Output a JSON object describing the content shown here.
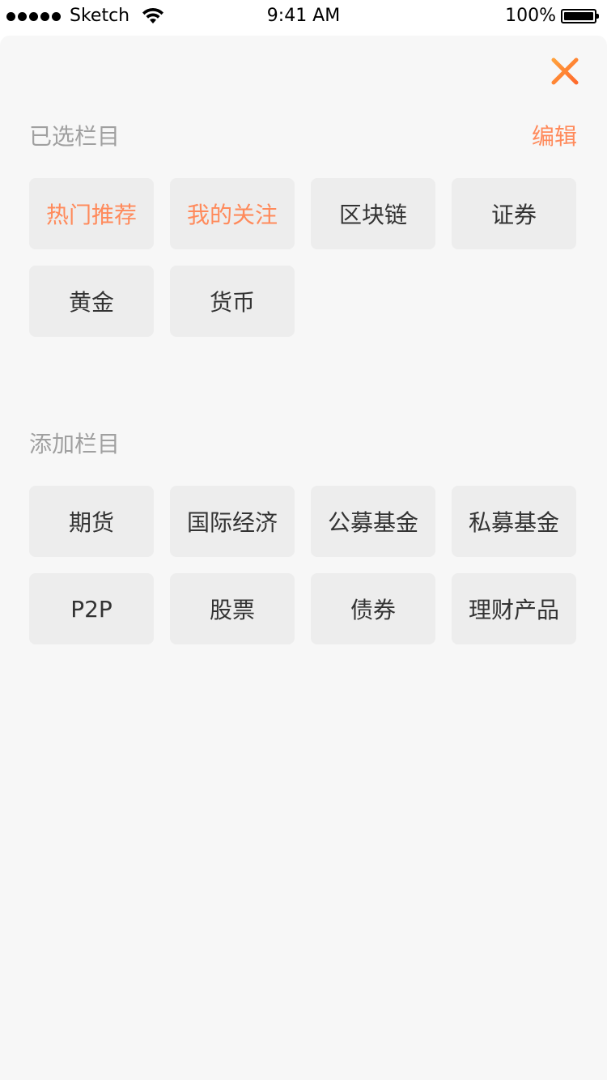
{
  "status_bar": {
    "carrier": "Sketch",
    "time": "9:41 AM",
    "battery": "100%"
  },
  "header": {
    "close_icon": "close-icon",
    "accent_color": "#ff8a5b"
  },
  "selected": {
    "title": "已选栏目",
    "edit_label": "编辑",
    "items": [
      {
        "label": "热门推荐",
        "active": true
      },
      {
        "label": "我的关注",
        "active": true
      },
      {
        "label": "区块链",
        "active": false
      },
      {
        "label": "证券",
        "active": false
      },
      {
        "label": "黄金",
        "active": false
      },
      {
        "label": "货币",
        "active": false
      }
    ]
  },
  "available": {
    "title": "添加栏目",
    "items": [
      {
        "label": "期货"
      },
      {
        "label": "国际经济"
      },
      {
        "label": "公募基金"
      },
      {
        "label": "私募基金"
      },
      {
        "label": "P2P"
      },
      {
        "label": "股票"
      },
      {
        "label": "债券"
      },
      {
        "label": "理财产品"
      }
    ]
  }
}
